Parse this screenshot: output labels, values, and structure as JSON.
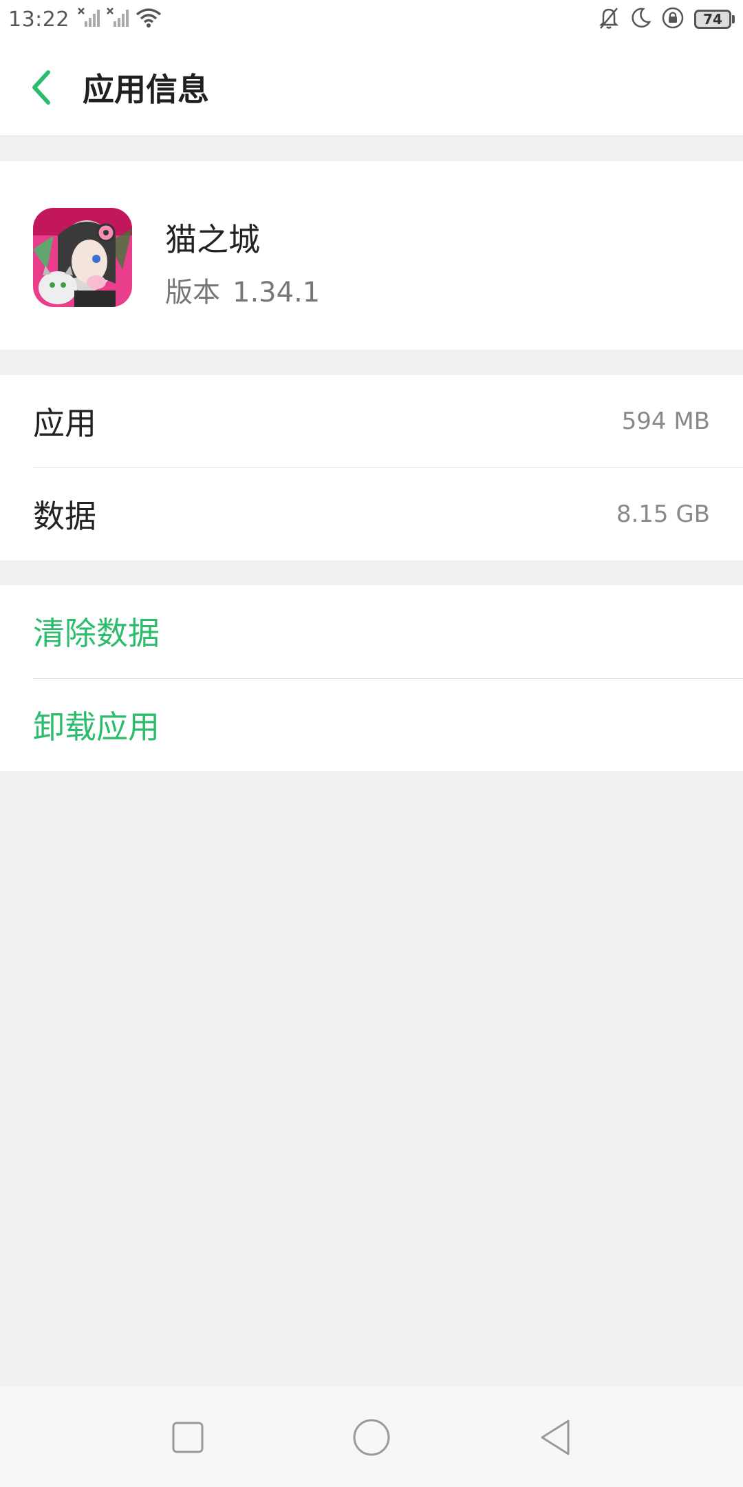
{
  "status_bar": {
    "time": "13:22",
    "battery_level": "74",
    "icons": [
      "signal-off-icon",
      "signal-off-icon",
      "wifi-icon",
      "mute-icon",
      "moon-icon",
      "rotation-lock-icon",
      "battery-icon"
    ]
  },
  "header": {
    "title": "应用信息",
    "back_icon": "chevron-left-icon"
  },
  "app": {
    "name": "猫之城",
    "version_label": "版本",
    "version_value": "1.34.1"
  },
  "storage": {
    "items": [
      {
        "label": "应用",
        "value": "594 MB"
      },
      {
        "label": "数据",
        "value": "8.15 GB"
      }
    ]
  },
  "actions": {
    "clear_data": "清除数据",
    "uninstall": "卸载应用"
  },
  "nav_bar": {
    "buttons": [
      "recents-square-icon",
      "home-circle-icon",
      "back-triangle-icon"
    ]
  },
  "colors": {
    "accent": "#2bbd6b",
    "background": "#f1f1f1",
    "card": "#ffffff",
    "secondary_text": "#888888"
  }
}
